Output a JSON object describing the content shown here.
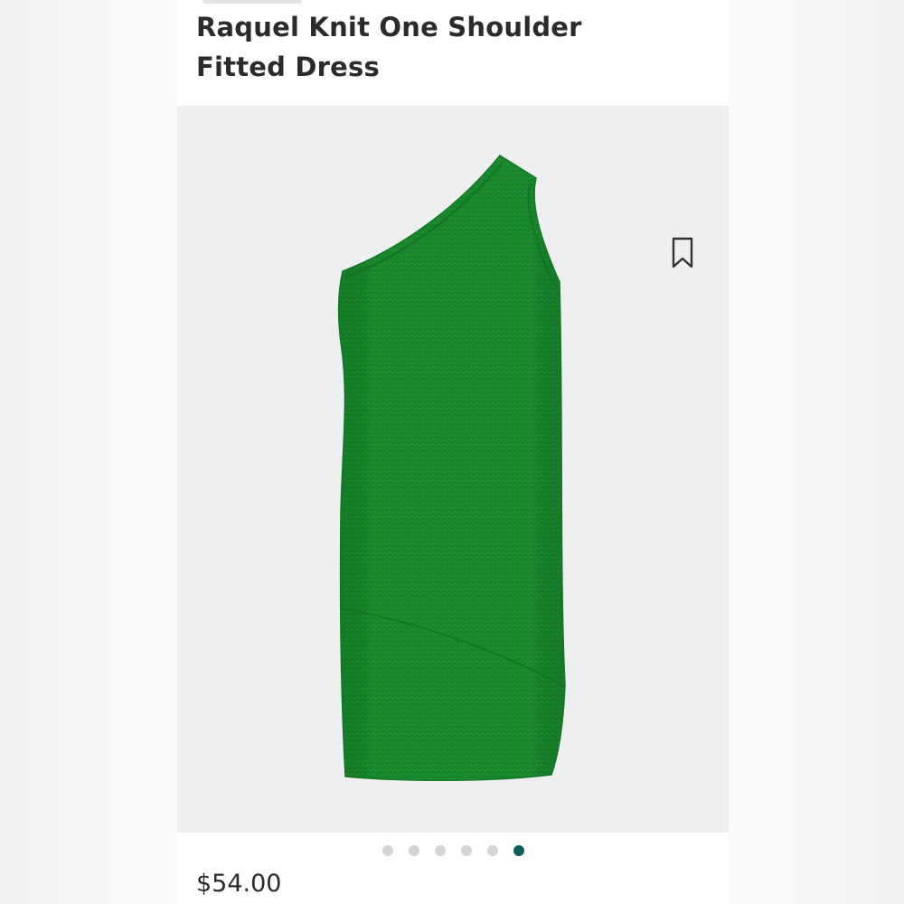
{
  "product": {
    "title_line1": "Raquel Knit One Shoulder",
    "title_line2": "Fitted Dress",
    "price": "$54.00",
    "image_alt": "Green one-shoulder knit fitted dress",
    "dress_color": "#1a8a2e"
  },
  "gallery": {
    "total_images": 6,
    "active_index": 5,
    "dot_color": "#d4d4d4",
    "active_dot_color": "#0f5e5c"
  },
  "icons": {
    "save": "bookmark-icon"
  }
}
